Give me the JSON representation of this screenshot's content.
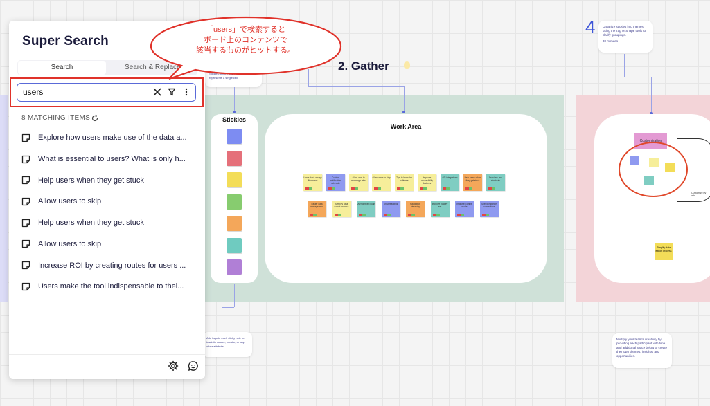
{
  "panel": {
    "title": "Super Search",
    "tabs": [
      {
        "label": "Search",
        "active": true
      },
      {
        "label": "Search & Replace",
        "active": false
      }
    ],
    "search": {
      "value": "users",
      "placeholder": ""
    },
    "match_count_label": "8 MATCHING ITEMS",
    "results": [
      {
        "text": "Explore how users make use of the data a..."
      },
      {
        "text": "What is essential to users? What is only h..."
      },
      {
        "text": "Help users when they get stuck"
      },
      {
        "text": "Allow users to skip"
      },
      {
        "text": "Help users when they get stuck"
      },
      {
        "text": "Allow users to skip"
      },
      {
        "text": "Increase ROI by creating routes for users ..."
      },
      {
        "text": "Users make the tool indispensable to thei..."
      }
    ],
    "footer_icons": [
      "gear-icon",
      "feedback-icon"
    ]
  },
  "callout": {
    "lines": [
      "「users」で検索すると",
      "ボード上のコンテンツで",
      "該当するものがヒットする。"
    ],
    "color": "#e0322a"
  },
  "canvas": {
    "section_heading": "2. Gather",
    "stickies_title": "Stickies",
    "work_area_title": "Work Area",
    "palette_colors": [
      "#7d8cf2",
      "#e5707a",
      "#f3dd58",
      "#87cc6f",
      "#f4a75a",
      "#6fcbc0",
      "#b07fd6"
    ],
    "work_notes_row1": [
      {
        "text": "Users don't always fit content",
        "color": "#f6ee9a"
      },
      {
        "text": "Custom notification schedule",
        "color": "#8f9af0"
      },
      {
        "text": "Allow user to rearrange tabs",
        "color": "#f6ee9a"
      },
      {
        "text": "Allow users to skip",
        "color": "#f6ee9a"
      },
      {
        "text": "Tips to learn the software",
        "color": "#f6ee9a"
      },
      {
        "text": "Improve accessibility features",
        "color": "#f6ee9a"
      },
      {
        "text": "API integrations",
        "color": "#7fcdc2"
      },
      {
        "text": "Help users when they get stuck",
        "color": "#f4a75a"
      },
      {
        "text": "Sessions and shortcuts",
        "color": "#7fcdc2"
      }
    ],
    "work_notes_row2": [
      {
        "text": "Faster data management",
        "color": "#f4a75a"
      },
      {
        "text": "Simplify data export process",
        "color": "#f6ee9a"
      },
      {
        "text": "User-defined goals",
        "color": "#7fcdc2"
      },
      {
        "text": "Universal links",
        "color": "#8f9af0"
      },
      {
        "text": "Navigation hierarchy",
        "color": "#f4a75a"
      },
      {
        "text": "Improve hockey set",
        "color": "#7fcdc2"
      },
      {
        "text": "Improved offline mode",
        "color": "#8f9af0"
      },
      {
        "text": "Speed instance connections",
        "color": "#8f9af0"
      }
    ],
    "top_card_text": "Stickies, where each sticky note represents a single cell.",
    "step_number": "4",
    "step_card": {
      "lines": [
        "Organize stickies into themes,",
        "using the Tag or Shape tools to",
        "clarify groupings."
      ],
      "duration": "30 minutes"
    },
    "bottom_card_left": "Add tags to each sticky note to track its source, creator, or any other attribute.",
    "bottom_card_right": "Multiply your team's creativity by providing each participant with time and additional space below to create their own themes, insights, and opportunities.",
    "customization_label": "Customization",
    "customization_note": "Customize by add...",
    "simplify_note": "Simplify data export process"
  }
}
